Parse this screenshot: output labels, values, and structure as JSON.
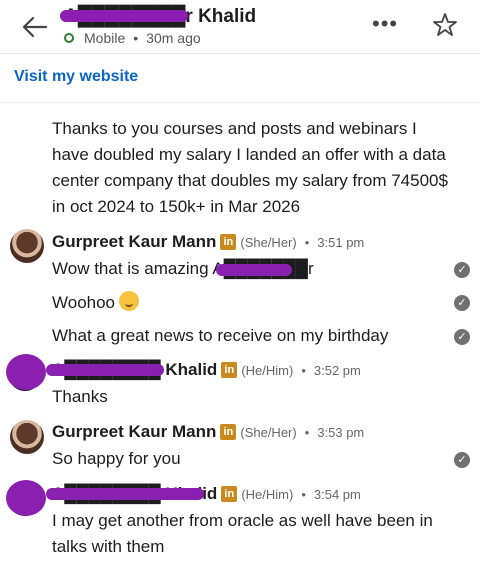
{
  "header": {
    "name": "A████████r Khalid",
    "status": "Mobile",
    "time_ago": "30m ago",
    "more": "•••"
  },
  "website": "Visit my website",
  "messages": {
    "first": "Thanks to you courses and posts and webinars I have doubled my salary I landed an offer with a data center company that doubles my salary from 74500$ in oct 2024 to 150k+ in Mar 2026",
    "g1_name": "Gurpreet Kaur Mann",
    "g1_pron": "(She/Her)",
    "g1_time": "3:51 pm",
    "g1_m1": "Wow that is amazing A███████r",
    "g1_m2": "Woohoo",
    "g1_m3": "What a great news to receive on my birthday",
    "a1_name": "A████████ Khalid",
    "a1_pron": "(He/Him)",
    "a1_time": "3:52 pm",
    "a1_m1": "Thanks",
    "g2_name": "Gurpreet Kaur Mann",
    "g2_pron": "(She/Her)",
    "g2_time": "3:53 pm",
    "g2_m1": "So happy for you",
    "a2_name": "A████████ Khalid",
    "a2_pron": "(He/Him)",
    "a2_time": "3:54 pm",
    "a2_m1": "I may get another from oracle as well have been in talks with them"
  },
  "badge": "in",
  "dot": "•",
  "colors": {
    "link": "#0a66c2",
    "redaction": "#8a1fb0",
    "badge": "#c88a1e"
  }
}
